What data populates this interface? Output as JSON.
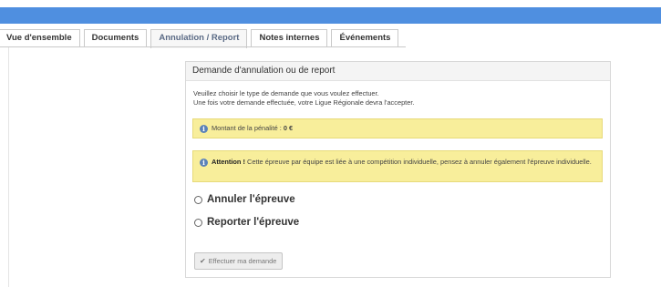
{
  "colors": {
    "topbar": "#4f8fe0",
    "alert_background": "#f8ee9b",
    "info_icon": "#5b82b8"
  },
  "tabs": [
    {
      "label": "Vue d'ensemble",
      "active": false
    },
    {
      "label": "Documents",
      "active": false
    },
    {
      "label": "Annulation / Report",
      "active": true
    },
    {
      "label": "Notes internes",
      "active": false
    },
    {
      "label": "Événements",
      "active": false
    }
  ],
  "card": {
    "title": "Demande d'annulation ou de report",
    "intro_line1": "Veuillez choisir le type de demande que vous voulez effectuer.",
    "intro_line2": "Une fois votre demande effectuée, votre Ligue Régionale devra l'accepter.",
    "penalty_label": "Montant de la pénalité : ",
    "penalty_value": "0 €",
    "attention_title": "Attention !",
    "attention_text": " Cette épreuve par équipe est liée à une compétition individuelle, pensez à annuler également l'épreuve individuelle.",
    "info_icon_glyph": "i",
    "options": [
      {
        "label": "Annuler l'épreuve",
        "selected": false
      },
      {
        "label": "Reporter l'épreuve",
        "selected": false
      }
    ],
    "submit_label": "Effectuer ma demande",
    "submit_icon": "check-icon",
    "submit_glyph": "✔"
  }
}
